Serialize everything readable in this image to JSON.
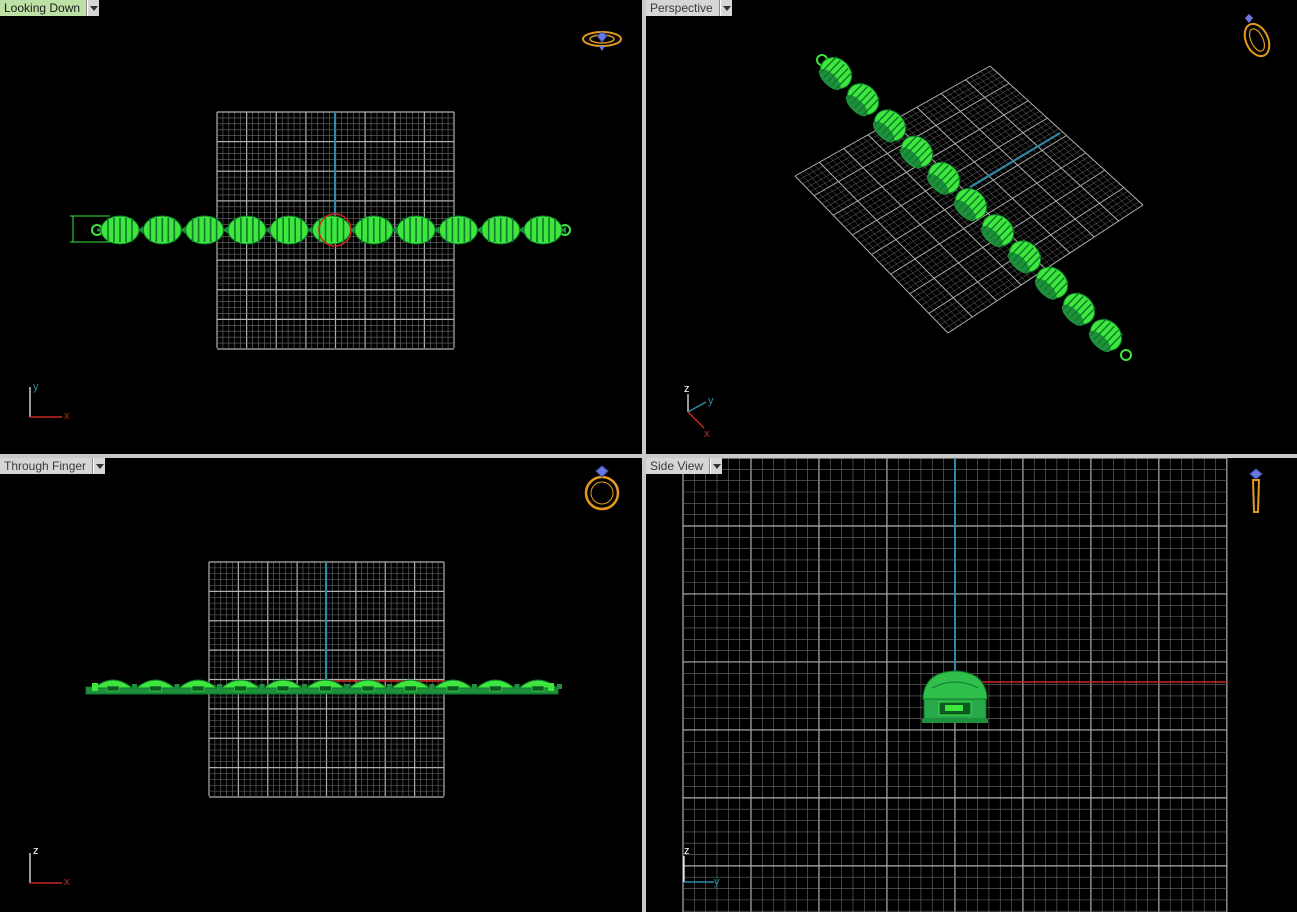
{
  "viewports": {
    "top_left": {
      "label": "Looking Down",
      "active": true
    },
    "top_right": {
      "label": "Perspective",
      "active": false
    },
    "bottom_left": {
      "label": "Through Finger",
      "active": false
    },
    "bottom_right": {
      "label": "Side View",
      "active": false
    }
  },
  "axes": {
    "top_left": [
      "y",
      "x"
    ],
    "top_right": [
      "z",
      "y",
      "x"
    ],
    "bottom_left": [
      "z",
      "x"
    ],
    "bottom_right": [
      "z",
      "y"
    ]
  },
  "view_icons": {
    "top_left": "ring-top-view-icon",
    "top_right": "ring-perspective-icon",
    "bottom_left": "ring-front-view-icon",
    "bottom_right": "ring-side-view-icon"
  },
  "colors": {
    "background": "#000000",
    "grid": "#8c8c8c",
    "model_green": "#3ee63e",
    "model_dark": "#0c7a2a",
    "axis_x": "#c8281e",
    "axis_y": "#2d8aa8",
    "axis_z": "#ffffff",
    "gizmo_orange": "#e39a1f",
    "active_tab": "#bde0a4"
  }
}
